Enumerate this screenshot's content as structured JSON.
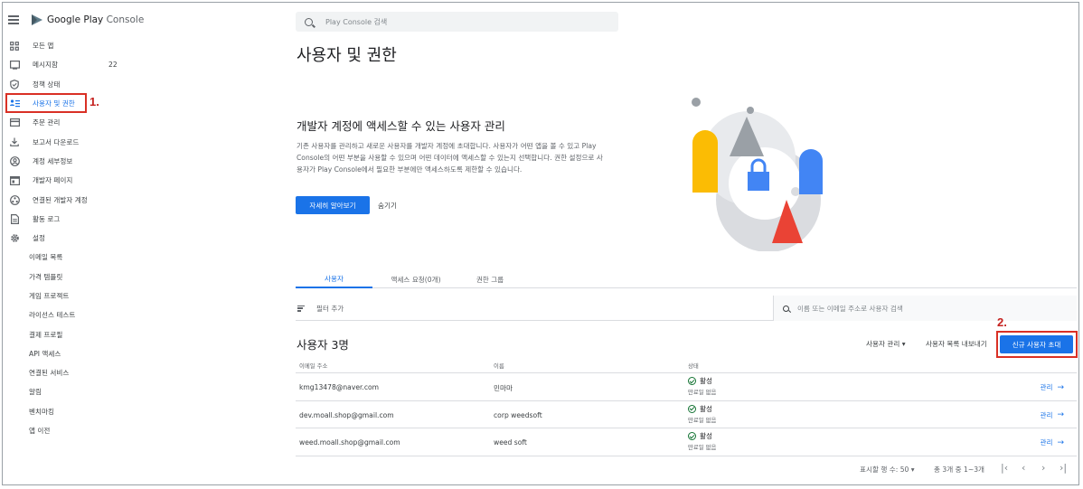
{
  "app": {
    "logo_text_bold": "Google Play",
    "logo_text_light": " Console"
  },
  "search": {
    "placeholder": "Play Console 검색"
  },
  "sidebar": {
    "items": [
      {
        "label": "모든 앱",
        "icon": "apps-grid-icon"
      },
      {
        "label": "메시지함",
        "icon": "inbox-icon",
        "badge": "22"
      },
      {
        "label": "정책 상태",
        "icon": "shield-icon"
      },
      {
        "label": "사용자 및 권한",
        "icon": "people-list-icon",
        "active": true
      },
      {
        "label": "주문 관리",
        "icon": "credit-card-icon"
      },
      {
        "label": "보고서 다운로드",
        "icon": "download-icon"
      },
      {
        "label": "계정 세부정보",
        "icon": "account-circle-icon"
      },
      {
        "label": "개발자 페이지",
        "icon": "web-page-icon"
      },
      {
        "label": "연결된 개발자 계정",
        "icon": "linked-accounts-icon"
      },
      {
        "label": "활동 로그",
        "icon": "document-icon"
      },
      {
        "label": "설정",
        "icon": "gear-icon"
      }
    ],
    "settings_sub": [
      "이메일 목록",
      "가격 템플릿",
      "게임 프로젝트",
      "라이선스 테스트",
      "결제 프로필",
      "API 액세스",
      "연결된 서비스",
      "알림",
      "벤치마킹",
      "앱 이전"
    ]
  },
  "annotations": {
    "step1": "1.",
    "step2": "2."
  },
  "main": {
    "page_title": "사용자 및 권한",
    "hero": {
      "title": "개발자 계정에 액세스할 수 있는 사용자 관리",
      "description": "기존 사용자를 관리하고 새로운 사용자를 개발자 계정에 초대합니다. 사용자가 어떤 앱을 볼 수 있고 Play Console의 어떤 부분을 사용할 수 있으며 어떤 데이터에 액세스할 수 있는지 선택합니다. 권한 설정으로 사용자가 Play Console에서 필요한 부분에만 액세스하도록 제한할 수 있습니다.",
      "learn_more": "자세히 알아보기",
      "hide": "숨기기"
    },
    "tabs": [
      "사용자",
      "액세스 요청(0개)",
      "권한 그룹"
    ],
    "filter": {
      "add_label": "필터 추가",
      "search_placeholder": "이름 또는 이메일 주소로 사용자 검색"
    },
    "users_heading": "사용자 3명",
    "actions": {
      "manage_users": "사용자 관리 ▾",
      "export": "사용자 목록 내보내기",
      "invite": "신규 사용자 초대"
    },
    "table": {
      "headers": {
        "email": "이메일 주소",
        "name": "이름",
        "status": "상태"
      },
      "rows": [
        {
          "email": "kmg13478@naver.com",
          "name": "민마마",
          "status": "활성",
          "expiry": "만료일 없음",
          "action": "관리"
        },
        {
          "email": "dev.moall.shop@gmail.com",
          "name": "corp weedsoft",
          "status": "활성",
          "expiry": "만료일 없음",
          "action": "관리"
        },
        {
          "email": "weed.moall.shop@gmail.com",
          "name": "weed soft",
          "status": "활성",
          "expiry": "만료일 없음",
          "action": "관리"
        }
      ]
    },
    "pagination": {
      "rows_per_page": "표시할 행 수: 50 ▾",
      "count": "총 3개 중 1~3개"
    }
  },
  "colors": {
    "accent": "#1a73e8",
    "highlight": "#d93025",
    "yellow": "#fbbc04",
    "red": "#ea4335",
    "gray": "#dadce0"
  }
}
